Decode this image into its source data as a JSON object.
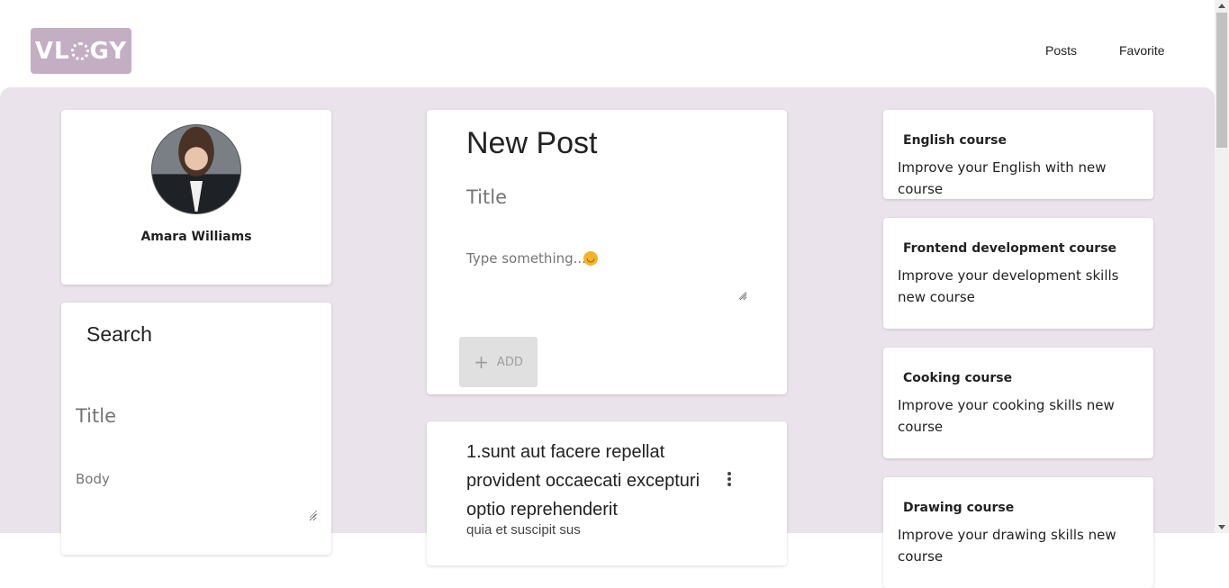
{
  "header": {
    "logo_text": "VLOGY",
    "nav": {
      "posts": "Posts",
      "favorite": "Favorite"
    }
  },
  "profile": {
    "name": "Amara Williams"
  },
  "search": {
    "heading": "Search",
    "title_placeholder": "Title",
    "body_placeholder": "Body"
  },
  "new_post": {
    "heading": "New Post",
    "title_placeholder": "Title",
    "body_placeholder": "Type something...",
    "add_label": "ADD"
  },
  "posts": [
    {
      "title": "1.sunt aut facere repellat provident occaecati excepturi optio reprehenderit",
      "body_preview": "quia et suscipit sus"
    }
  ],
  "courses": [
    {
      "title": "English course",
      "description": "Improve your English with new course"
    },
    {
      "title": "Frontend development course",
      "description": "Improve your development skills new course"
    },
    {
      "title": "Cooking course",
      "description": "Improve your cooking skills new course"
    },
    {
      "title": "Drawing course",
      "description": "Improve your drawing skills new course"
    }
  ],
  "colors": {
    "accent": "#c3aec4",
    "background": "#ebe3eb"
  }
}
